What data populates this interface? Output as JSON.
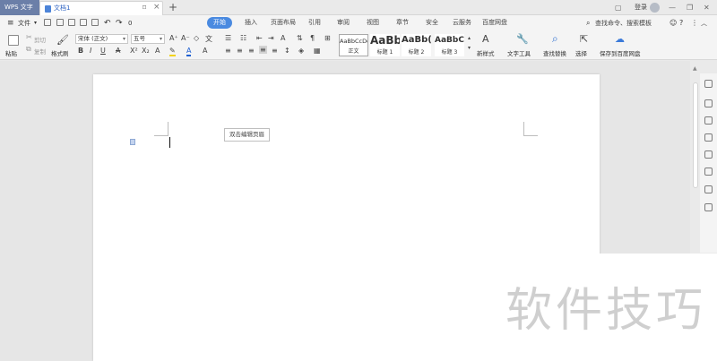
{
  "titlebar": {
    "app_name": "WPS 文字",
    "doc_name": "文档1",
    "login": "登录"
  },
  "menubar": {
    "file_label": "文件",
    "quick_count": "0",
    "tabs": [
      "开始",
      "插入",
      "页面布局",
      "引用",
      "审阅",
      "视图",
      "章节",
      "安全",
      "云服务",
      "百度网盘"
    ],
    "search_commands": "查找命令、搜索模板"
  },
  "ribbon": {
    "paste": "粘贴",
    "cut": "剪切",
    "copy": "复制",
    "format_painter": "格式刷",
    "font_name": "宋体 (正文)",
    "font_size": "五号",
    "styles": [
      {
        "sample": "AaBbCcDd",
        "name": "正文"
      },
      {
        "sample": "AaBb",
        "name": "标题 1"
      },
      {
        "sample": "AaBb(",
        "name": "标题 2"
      },
      {
        "sample": "AaBbC",
        "name": "标题 3"
      }
    ],
    "new_style": "新样式",
    "text_tools": "文字工具",
    "find_replace": "查找替换",
    "select": "选择",
    "save_baidu": "保存到百度网盘"
  },
  "document": {
    "header_hint": "双击编辑页眉"
  },
  "watermark": "软件技巧",
  "colors": {
    "accent": "#4a8ae0",
    "app_tab": "#6b7fa8",
    "font_color_a": "#1f5fd1",
    "highlight": "#f2d21a"
  }
}
